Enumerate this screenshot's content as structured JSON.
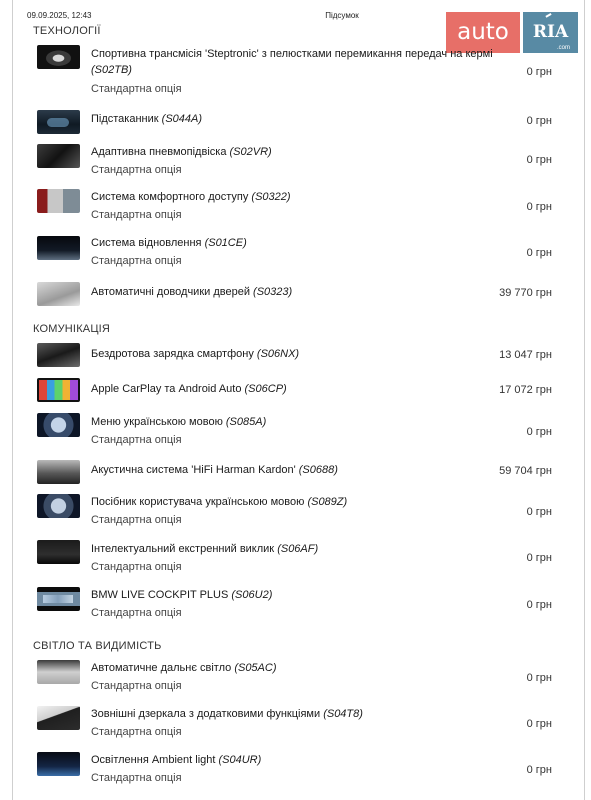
{
  "header": {
    "datetime": "09.09.2025, 12:43",
    "title": "Підсумок"
  },
  "watermark": {
    "auto": "auto",
    "ria": "RIA",
    "ria_sub": ".com"
  },
  "sections": [
    {
      "title": "ТЕХНОЛОГІЇ",
      "items": [
        {
          "title": "Спортивна трансмісія 'Steptronic' з пелюстками перемикання передач на кермі",
          "code": "(S02TB)",
          "subtitle": "Стандартна опція",
          "price": "0 грн",
          "icon": "steptronic-thumbnail"
        },
        {
          "title": "Підстаканник",
          "code": "(S044A)",
          "subtitle": "",
          "price": "0 грн",
          "icon": "cupholder-thumbnail"
        },
        {
          "title": "Адаптивна пневмопідвіска",
          "code": "(S02VR)",
          "subtitle": "Стандартна опція",
          "price": "0 грн",
          "icon": "suspension-thumbnail"
        },
        {
          "title": "Система комфортного доступу",
          "code": "(S0322)",
          "subtitle": "Стандартна опція",
          "price": "0 грн",
          "icon": "comfort-access-thumbnail"
        },
        {
          "title": "Система відновлення",
          "code": "(S01CE)",
          "subtitle": "Стандартна опція",
          "price": "0 грн",
          "icon": "restore-thumbnail"
        },
        {
          "title": "Автоматичні доводчики дверей",
          "code": "(S0323)",
          "subtitle": "",
          "price": "39 770 грн",
          "icon": "door-closer-thumbnail"
        }
      ]
    },
    {
      "title": "КОМУНІКАЦІЯ",
      "items": [
        {
          "title": "Бездротова зарядка смартфону",
          "code": "(S06NX)",
          "subtitle": "",
          "price": "13 047 грн",
          "icon": "wireless-charging-thumbnail"
        },
        {
          "title": "Apple CarPlay та Android Auto",
          "code": "(S06CP)",
          "subtitle": "",
          "price": "17 072 грн",
          "icon": "carplay-thumbnail"
        },
        {
          "title": "Меню українською мовою",
          "code": "(S085A)",
          "subtitle": "Стандартна опція",
          "price": "0 грн",
          "icon": "menu-language-thumbnail"
        },
        {
          "title": "Акустична система 'HiFi Harman Kardon'",
          "code": "(S0688)",
          "subtitle": "",
          "price": "59 704 грн",
          "icon": "harman-kardon-thumbnail"
        },
        {
          "title": "Посібник користувача українською мовою",
          "code": "(S089Z)",
          "subtitle": "Стандартна опція",
          "price": "0 грн",
          "icon": "manual-thumbnail"
        },
        {
          "title": "Інтелектуальний екстренний виклик",
          "code": "(S06AF)",
          "subtitle": "Стандартна опція",
          "price": "0 грн",
          "icon": "emergency-call-thumbnail"
        },
        {
          "title": "BMW LIVE COCKPIT PLUS",
          "code": "(S06U2)",
          "subtitle": "Стандартна опція",
          "price": "0 грн",
          "icon": "live-cockpit-thumbnail"
        }
      ]
    },
    {
      "title": "СВІТЛО ТА ВИДИМІСТЬ",
      "items": [
        {
          "title": "Автоматичне дальнє світло",
          "code": "(S05AC)",
          "subtitle": "Стандартна опція",
          "price": "0 грн",
          "icon": "high-beam-thumbnail"
        },
        {
          "title": "Зовнішні дзеркала з додатковими функціями",
          "code": "(S04T8)",
          "subtitle": "Стандартна опція",
          "price": "0 грн",
          "icon": "mirrors-thumbnail"
        },
        {
          "title": "Освітлення Ambient light",
          "code": "(S04UR)",
          "subtitle": "Стандартна опція",
          "price": "0 грн",
          "icon": "ambient-light-thumbnail"
        }
      ]
    }
  ]
}
